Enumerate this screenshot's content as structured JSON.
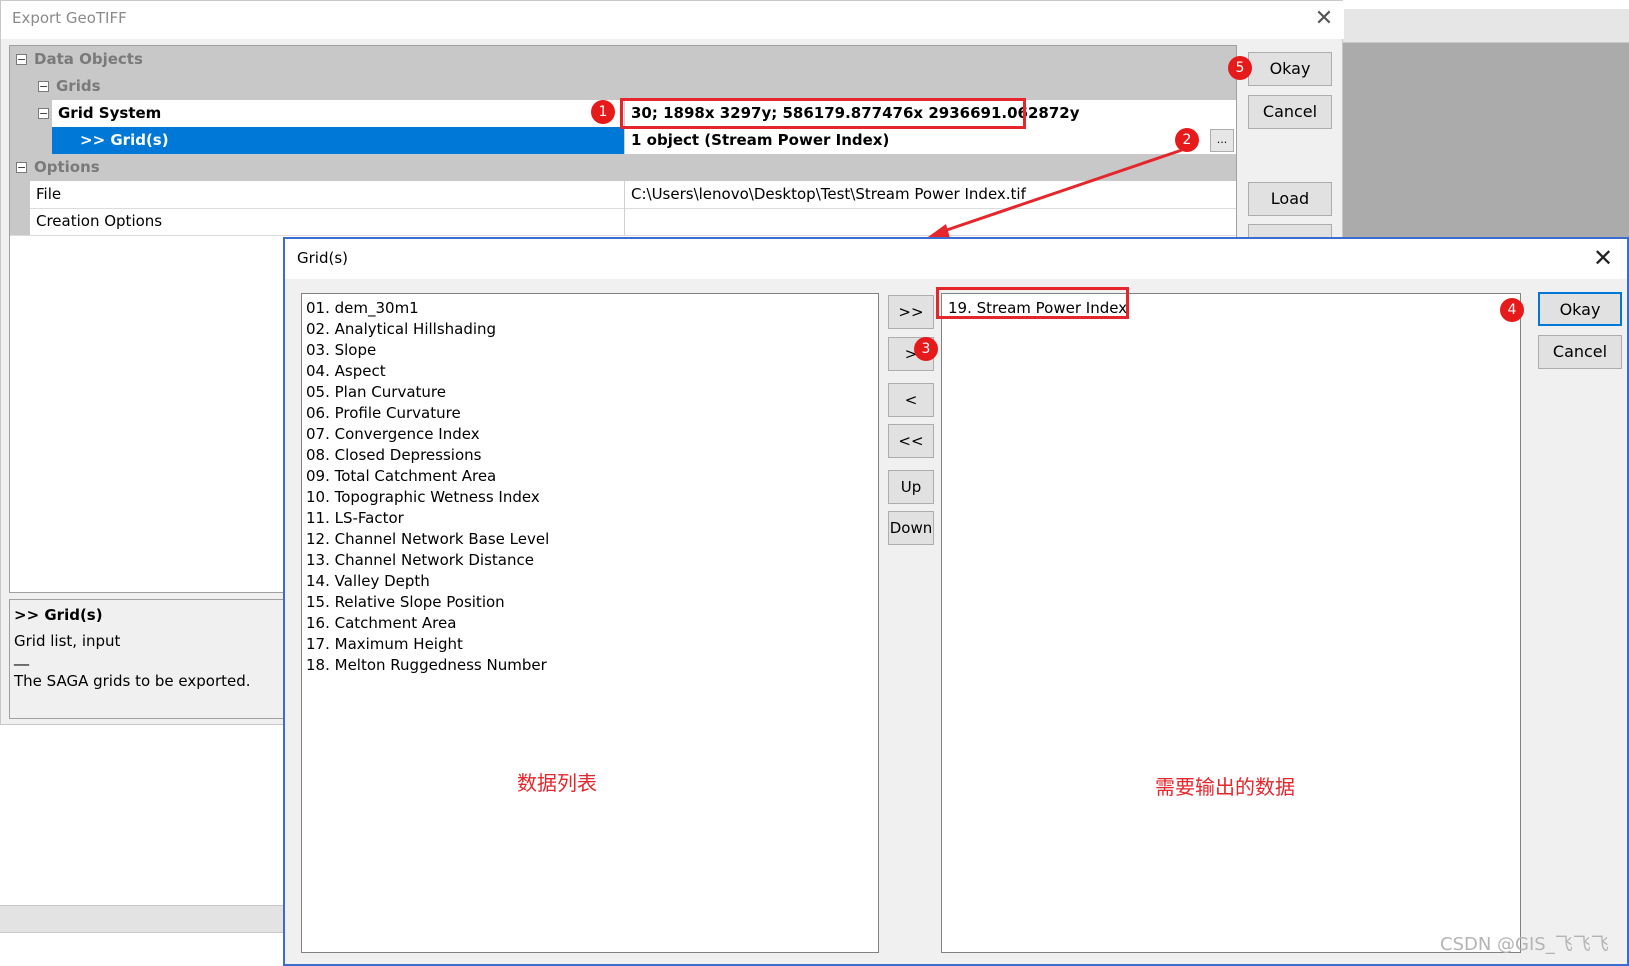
{
  "main_dialog": {
    "title": "Export GeoTIFF",
    "close_glyph": "✕",
    "tree": {
      "data_objects": "Data Objects",
      "grids": "Grids",
      "grid_system_label": "Grid System",
      "grid_system_value": "30; 1898x 3297y; 586179.877476x 2936691.062872y",
      "grids_label": ">> Grid(s)",
      "grids_value": "1 object (Stream Power Index)",
      "ellipsis": "...",
      "options": "Options",
      "file_label": "File",
      "file_value": "C:\\Users\\lenovo\\Desktop\\Test\\Stream Power Index.tif",
      "creation_options_label": "Creation Options",
      "creation_options_value": ""
    },
    "buttons": {
      "okay": "Okay",
      "cancel": "Cancel",
      "load": "Load"
    },
    "description": {
      "title": ">> Grid(s)",
      "type": "Grid list, input",
      "separator": "__",
      "text": "The SAGA grids to be exported."
    },
    "toggle_glyph": "−"
  },
  "grid_dialog": {
    "title": "Grid(s)",
    "close_glyph": "✕",
    "available_items": [
      "01. dem_30m1",
      "02. Analytical Hillshading",
      "03. Slope",
      "04. Aspect",
      "05. Plan Curvature",
      "06. Profile Curvature",
      "07. Convergence Index",
      "08. Closed Depressions",
      "09. Total Catchment Area",
      "10. Topographic Wetness Index",
      "11. LS-Factor",
      "12. Channel Network Base Level",
      "13. Channel Network Distance",
      "14. Valley Depth",
      "15. Relative Slope Position",
      "16. Catchment Area",
      "17. Maximum Height",
      "18. Melton Ruggedness Number"
    ],
    "selected_items": [
      "19. Stream Power Index"
    ],
    "move_buttons": {
      "add_all": ">>",
      "add": ">",
      "remove": "<",
      "remove_all": "<<",
      "up": "Up",
      "down": "Down"
    },
    "buttons": {
      "okay": "Okay",
      "cancel": "Cancel"
    },
    "annotation_left": "数据列表",
    "annotation_right": "需要输出的数据"
  },
  "badges": {
    "b1": "1",
    "b2": "2",
    "b3": "3",
    "b4": "4",
    "b5": "5"
  },
  "watermark": "CSDN @GIS_飞飞飞",
  "colors": {
    "selection": "#0078d7",
    "annotation_red": "#e5262c",
    "dialog_border": "#3b6ccf"
  }
}
